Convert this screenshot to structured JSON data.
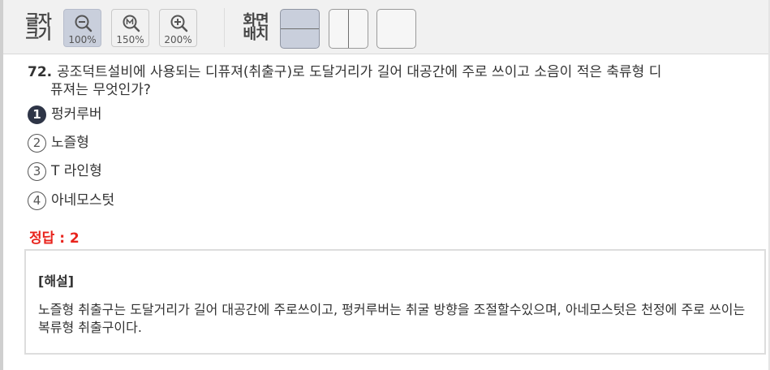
{
  "toolbar": {
    "font_size_label_line1": "글자",
    "font_size_label_line2": "크기",
    "zoom_buttons": [
      {
        "icon": "zoom-out-icon",
        "label": "100%",
        "active": true
      },
      {
        "icon": "zoom-medium-icon",
        "label": "150%",
        "active": false
      },
      {
        "icon": "zoom-in-icon",
        "label": "200%",
        "active": false
      }
    ],
    "layout_label_line1": "화면",
    "layout_label_line2": "배치",
    "layout_buttons": [
      {
        "icon": "layout-horizontal-split-icon",
        "active": true
      },
      {
        "icon": "layout-vertical-split-icon",
        "active": false
      },
      {
        "icon": "layout-single-icon",
        "active": false
      }
    ]
  },
  "question": {
    "number": "72.",
    "text_line1": "공조덕트설비에 사용되는 디퓨져(취출구)로 도달거리가 길어 대공간에 주로 쓰이고 소음이 적은 축류형 디",
    "text_line2": "퓨져는 무엇인가?"
  },
  "choices": [
    {
      "num": "1",
      "text": "펑커루버",
      "selected": true
    },
    {
      "num": "2",
      "text": "노즐형",
      "selected": false
    },
    {
      "num": "3",
      "text": "T 라인형",
      "selected": false
    },
    {
      "num": "4",
      "text": "아네모스텃",
      "selected": false
    }
  ],
  "answer": {
    "label": "정답 : 2"
  },
  "explanation": {
    "title": "[해설]",
    "body": "노즐형 취출구는 도달거리가 길어 대공간에 주로쓰이고, 펑커루버는 취굴 방향을 조절할수있으며, 아네모스텃은 천정에 주로 쓰이는 복류형 취출구이다."
  },
  "colors": {
    "answer_red": "#e8231c",
    "active_button": "#c9cfdc",
    "selected_choice": "#2e3547"
  }
}
